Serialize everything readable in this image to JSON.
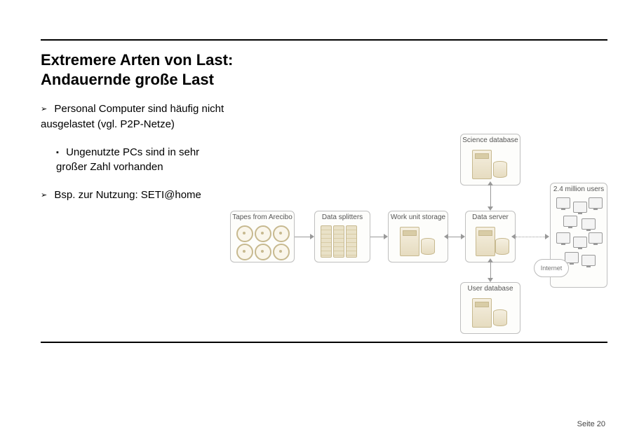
{
  "title_line1": "Extremere Arten von Last:",
  "title_line2": "Andauernde große Last",
  "bullet1": "Personal Computer sind häufig nicht ausgelastet (vgl. P2P-Netze)",
  "bullet1a": "Ungenutzte PCs sind in sehr großer Zahl vorhanden",
  "bullet2": "Bsp. zur Nutzung: SETI@home",
  "diagram": {
    "tapes": "Tapes from Arecibo",
    "splitters": "Data splitters",
    "workunit": "Work unit storage",
    "science": "Science database",
    "dataserver": "Data server",
    "userdb": "User database",
    "users": "2.4 million users",
    "internet": "Internet"
  },
  "page_label": "Seite 20"
}
